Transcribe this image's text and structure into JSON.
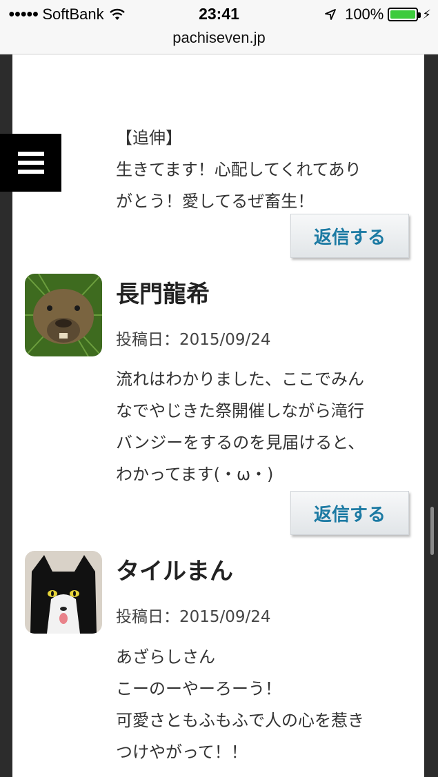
{
  "status_bar": {
    "signal": "●●●●●",
    "carrier": "SoftBank",
    "time": "23:41",
    "battery_pct": "100%",
    "battery_level": 1.0
  },
  "url_bar": {
    "domain": "pachiseven.jp"
  },
  "menu": {
    "icon": "hamburger-icon"
  },
  "comments": [
    {
      "lines": [
        "【追伸】",
        "生きてます！心配してくれてあり",
        "がとう！愛してるぜ畜生！"
      ],
      "reply_label": "返信する"
    },
    {
      "author": "長門龍希",
      "avatar_icon": "capybara-avatar",
      "date": "投稿日：2015/09/24",
      "lines": [
        "流れはわかりました、ここでみん",
        "なでやじきた祭開催しながら滝行",
        "バンジーをするのを見届けると、",
        "わかってます(・ω・)"
      ],
      "reply_label": "返信する"
    },
    {
      "author": "タイルまん",
      "avatar_icon": "cat-avatar",
      "date": "投稿日：2015/09/24",
      "lines": [
        "あざらしさん",
        "こーのーやーろーう！",
        "可愛さともふもふで人の心を惹き",
        "つけやがって！！"
      ]
    }
  ]
}
